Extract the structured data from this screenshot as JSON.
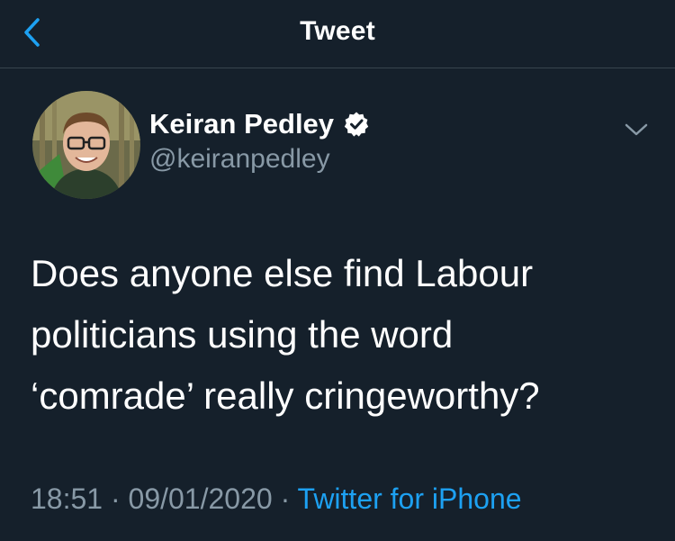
{
  "nav": {
    "title": "Tweet",
    "back_icon": "chevron-left-icon"
  },
  "colors": {
    "background": "#15202b",
    "accent": "#1da1f2",
    "secondary_text": "#8899a6",
    "divider": "#38444d"
  },
  "tweet": {
    "author_name": "Keiran Pedley",
    "author_handle": "@keiranpedley",
    "verified": true,
    "verified_icon": "verified-badge-icon",
    "menu_icon": "chevron-down-icon",
    "text_lines": [
      "Does anyone else find Labour",
      "politicians using the word",
      "‘comrade’ really cringeworthy?"
    ],
    "time": "18:51",
    "separator": "·",
    "date": "09/01/2020",
    "source": "Twitter for iPhone"
  }
}
